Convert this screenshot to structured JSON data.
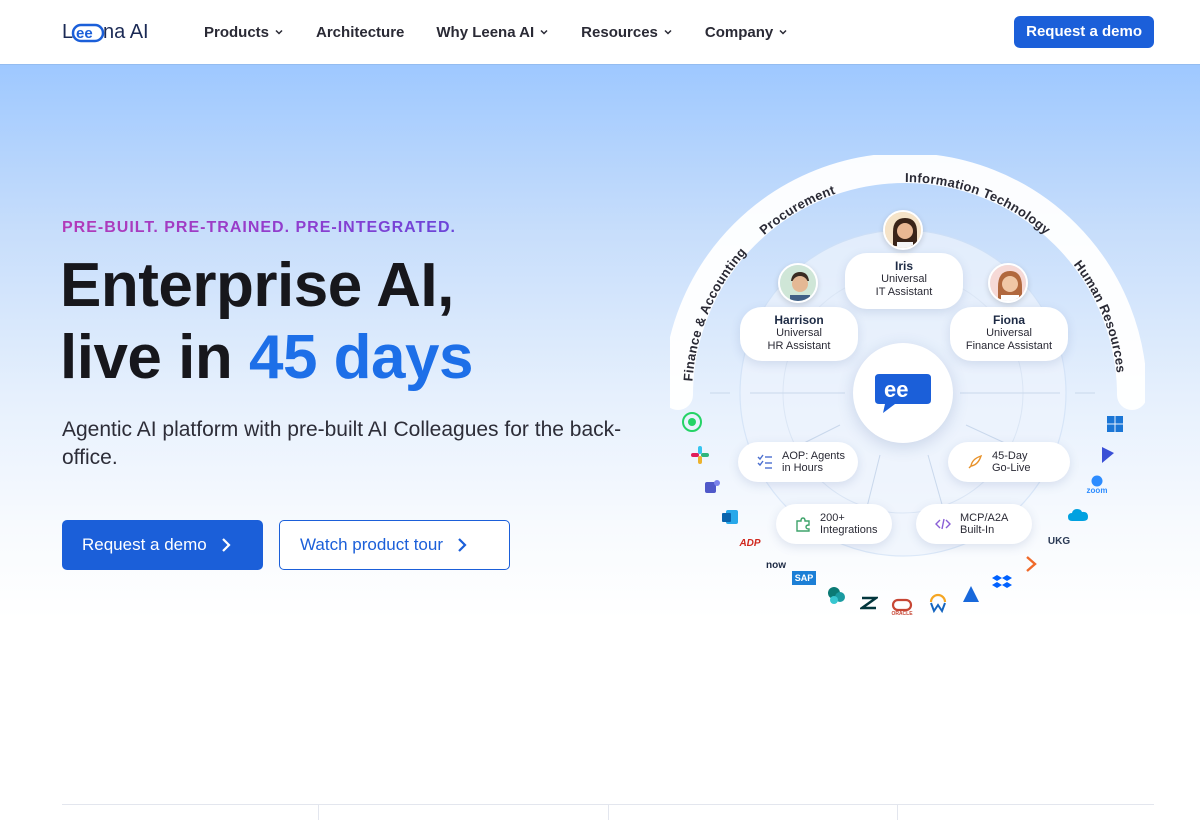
{
  "brand": {
    "name": "Leena AI",
    "accent": "#1b5fd9",
    "highlight": "#1d6fe8"
  },
  "nav": {
    "items": [
      {
        "label": "Products",
        "has_dropdown": true
      },
      {
        "label": "Architecture",
        "has_dropdown": false
      },
      {
        "label": "Why Leena AI",
        "has_dropdown": true
      },
      {
        "label": "Resources",
        "has_dropdown": true
      },
      {
        "label": "Company",
        "has_dropdown": true
      }
    ],
    "cta_label": "Request a demo"
  },
  "hero": {
    "eyebrow": "PRE-BUILT. PRE-TRAINED. PRE-INTEGRATED.",
    "title_line1": "Enterprise AI,",
    "title_line2_prefix": "live in ",
    "title_line2_accent": "45 days",
    "subtitle": "Agentic AI platform with pre-built AI Colleagues for the back-office.",
    "primary_button": "Request a demo",
    "secondary_button": "Watch product tour"
  },
  "diagram": {
    "arc_labels": [
      "Finance & Accounting",
      "Procurement",
      "Information Technology",
      "Human Resources"
    ],
    "agents": [
      {
        "name": "Iris",
        "role_line1": "Universal",
        "role_line2": "IT Assistant"
      },
      {
        "name": "Harrison",
        "role_line1": "Universal",
        "role_line2": "HR Assistant"
      },
      {
        "name": "Fiona",
        "role_line1": "Universal",
        "role_line2": "Finance Assistant"
      }
    ],
    "features": [
      {
        "line1": "AOP: Agents",
        "line2": "in Hours",
        "icon": "checklist-icon"
      },
      {
        "line1": "45-Day",
        "line2": "Go-Live",
        "icon": "rocket-icon"
      },
      {
        "line1": "200+",
        "line2": "Integrations",
        "icon": "puzzle-icon"
      },
      {
        "line1": "MCP/A2A",
        "line2": "Built-In",
        "icon": "code-icon"
      }
    ],
    "integration_logos": [
      "whatsapp",
      "slack",
      "teams",
      "outlook",
      "ADP",
      "now",
      "SAP",
      "sharepoint",
      "zendesk",
      "oracle",
      "workday",
      "atlassian",
      "dropbox",
      "bamboohr",
      "UKG",
      "salesforce",
      "zoom",
      "dynamics",
      "windows"
    ],
    "logo_text": {
      "adp": "ADP",
      "now": "now",
      "sap": "SAP",
      "ukg": "UKG",
      "zoom": "zoom",
      "oracle": "ORACLE"
    }
  }
}
